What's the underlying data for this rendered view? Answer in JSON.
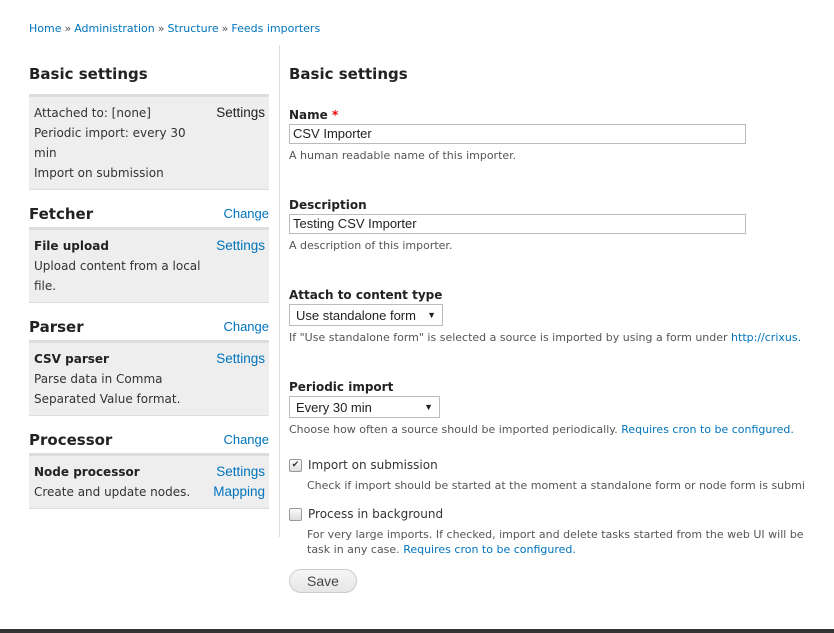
{
  "breadcrumb": [
    "Home",
    "Administration",
    "Structure",
    "Feeds importers"
  ],
  "breadcrumb_separator": "»",
  "sidebar": {
    "title": "Basic settings",
    "basic_panel": {
      "lines": [
        "Attached to: [none]",
        "Periodic import: every 30 min",
        "Import on submission"
      ],
      "link": "Settings"
    },
    "sections": [
      {
        "title": "Fetcher",
        "change": "Change",
        "plugin": "File upload",
        "description": "Upload content from a local file.",
        "links": [
          "Settings"
        ]
      },
      {
        "title": "Parser",
        "change": "Change",
        "plugin": "CSV parser",
        "description": "Parse data in Comma Separated Value format.",
        "links": [
          "Settings"
        ]
      },
      {
        "title": "Processor",
        "change": "Change",
        "plugin": "Node processor",
        "description": "Create and update nodes.",
        "links": [
          "Settings",
          "Mapping"
        ]
      }
    ]
  },
  "form": {
    "title": "Basic settings",
    "name": {
      "label": "Name",
      "required_mark": "*",
      "value": "CSV Importer",
      "description": "A human readable name of this importer."
    },
    "description": {
      "label": "Description",
      "value": "Testing CSV Importer",
      "description": "A description of this importer."
    },
    "content_type": {
      "label": "Attach to content type",
      "value": "Use standalone form",
      "description": "If \"Use standalone form\" is selected a source is imported by using a form under ",
      "description_link": "http://crixus."
    },
    "periodic": {
      "label": "Periodic import",
      "value": "Every 30 min",
      "description": "Choose how often a source should be imported periodically. ",
      "description_link": "Requires cron to be configured."
    },
    "import_on_submission": {
      "label": "Import on submission",
      "checked": true,
      "description": "Check if import should be started at the moment a standalone form or node form is submi"
    },
    "process_background": {
      "label": "Process in background",
      "checked": false,
      "description_line1": "For very large imports. If checked, import and delete tasks started from the web UI will be",
      "description_line2": "task in any case. ",
      "description_link": "Requires cron to be configured."
    },
    "save_label": "Save"
  },
  "colors": {
    "link": "#0074bd",
    "required": "#ee0000",
    "panel_bg": "#eeeeee"
  }
}
